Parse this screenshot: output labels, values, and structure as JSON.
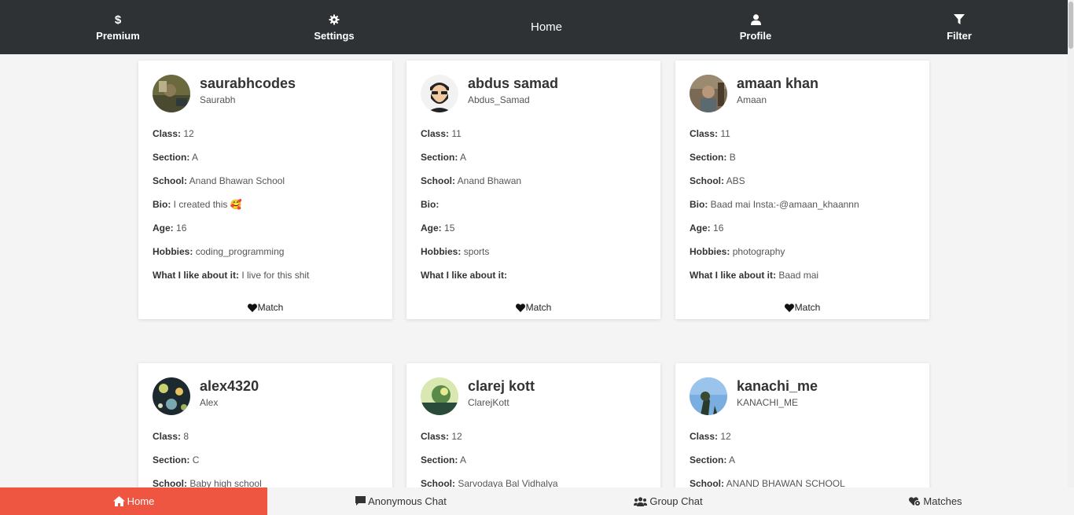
{
  "topnav": {
    "premium": "Premium",
    "settings": "Settings",
    "home": "Home",
    "profile": "Profile",
    "filter": "Filter"
  },
  "labels": {
    "class": "Class:",
    "section": "Section:",
    "school": "School:",
    "bio": "Bio:",
    "age": "Age:",
    "hobbies": "Hobbies:",
    "like": "What I like about it:",
    "match": "Match"
  },
  "cards": [
    {
      "username": "saurabhcodes",
      "display": "Saurabh",
      "class": "12",
      "section": "A",
      "school": "Anand Bhawan School",
      "bio": "I created this 🥰",
      "age": "16",
      "hobbies": "coding_programming",
      "like": "I live for this shit"
    },
    {
      "username": "abdus samad",
      "display": "Abdus_Samad",
      "class": "11",
      "section": "A",
      "school": "Anand Bhawan",
      "bio": "",
      "age": "15",
      "hobbies": "sports",
      "like": ""
    },
    {
      "username": "amaan khan",
      "display": "Amaan",
      "class": "11",
      "section": "B",
      "school": "ABS",
      "bio": "Baad mai Insta:-@amaan_khaannn",
      "age": "16",
      "hobbies": "photography",
      "like": "Baad mai"
    },
    {
      "username": "alex4320",
      "display": "Alex",
      "class": "8",
      "section": "C",
      "school": "Baby high school"
    },
    {
      "username": "clarej kott",
      "display": "ClarejKott",
      "class": "12",
      "section": "A",
      "school": "Sarvodaya Bal Vidhalya"
    },
    {
      "username": "kanachi_me",
      "display": "KANACHI_ME",
      "class": "12",
      "section": "A",
      "school": "ANAND BHAWAN SCHOOL"
    }
  ],
  "bottomnav": {
    "home": "Home",
    "anonymous": "Anonymous Chat",
    "group": "Group Chat",
    "matches": "Matches"
  },
  "colors": {
    "topnav_bg": "#2f3234",
    "active_tab": "#ee5642",
    "page_bg": "#f4f4f4"
  }
}
